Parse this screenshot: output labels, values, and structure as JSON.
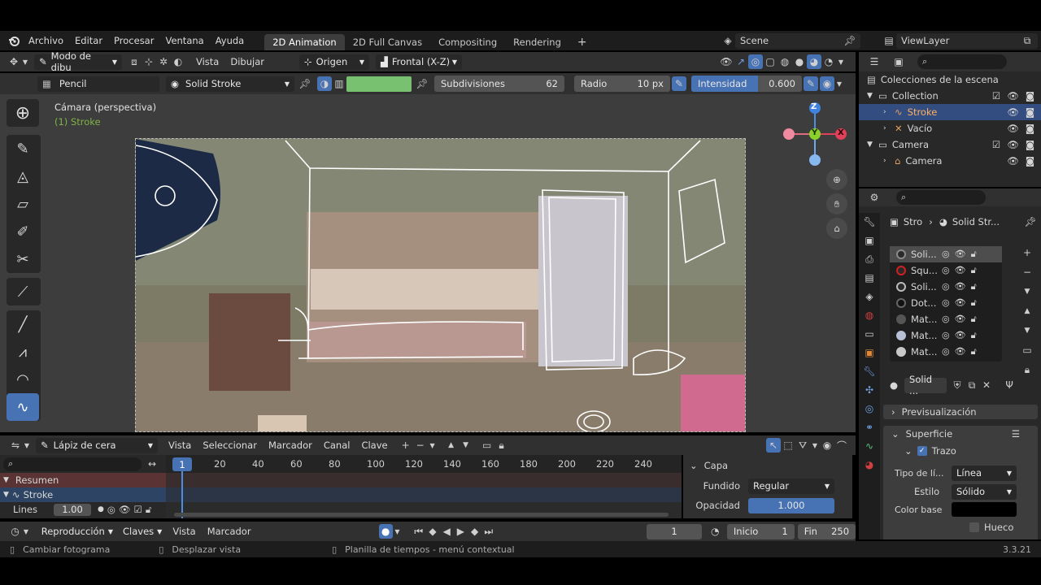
{
  "topbar": {
    "menus": [
      "Archivo",
      "Editar",
      "Procesar",
      "Ventana",
      "Ayuda"
    ],
    "workspaces": [
      "2D Animation",
      "2D Full Canvas",
      "Compositing",
      "Rendering"
    ],
    "add_tab": "+",
    "scene": "Scene",
    "view_layer": "ViewLayer"
  },
  "viewport_header": {
    "mode": "Modo de dibu",
    "view_menu": "Vista",
    "draw_menu": "Dibujar",
    "origin": "Origen",
    "orientation": "Frontal (X-Z)"
  },
  "tool_settings": {
    "brush": "Pencil",
    "material": "Solid Stroke",
    "color": "#78c170",
    "subdivisions_label": "Subdivisiones",
    "subdivisions_value": "62",
    "radius_label": "Radio",
    "radius_value": "10 px",
    "strength_label": "Intensidad",
    "strength_value": "0.600",
    "strength_fraction": 0.6
  },
  "viewport": {
    "camera_label": "Cámara (perspectiva)",
    "object_label": "(1) Stroke",
    "gizmo": {
      "z": "Z",
      "y": "Y",
      "x": "X"
    }
  },
  "outliner": {
    "root": "Colecciones de la escena",
    "items": [
      {
        "name": "Collection",
        "indent": 0,
        "icon": "collection-icon"
      },
      {
        "name": "Stroke",
        "indent": 1,
        "icon": "grease-pencil-icon",
        "selected": true
      },
      {
        "name": "Vacío",
        "indent": 1,
        "icon": "empty-icon"
      },
      {
        "name": "Camera",
        "indent": 0,
        "icon": "collection-icon"
      },
      {
        "name": "Camera",
        "indent": 1,
        "icon": "camera-icon"
      }
    ]
  },
  "properties": {
    "breadcrumb": [
      "Stro",
      "Solid Str..."
    ],
    "materials": [
      {
        "name": "Soli...",
        "color": "#2a2a2a",
        "ring": "#8a8a8a"
      },
      {
        "name": "Squ...",
        "color": "#2a2a2a",
        "ring": "#d02020"
      },
      {
        "name": "Soli...",
        "color": "#2a2a2a",
        "ring": "#bbbbbb"
      },
      {
        "name": "Dot...",
        "color": "#111111",
        "ring": "#666666"
      },
      {
        "name": "Mat...",
        "color": "#555555",
        "ring": "#555555"
      },
      {
        "name": "Mat...",
        "color": "#b8c0d8",
        "ring": "#b8c0d8"
      },
      {
        "name": "Mat...",
        "color": "#c8c8c8",
        "ring": "#c8c8c8"
      }
    ],
    "active_material": "Solid ...",
    "preview_label": "Previsualización",
    "surface_label": "Superficie",
    "stroke_label": "Trazo",
    "line_type_label": "Tipo de lí...",
    "line_type_value": "Línea",
    "style_label": "Estilo",
    "style_value": "Sólido",
    "base_color_label": "Color base",
    "base_color": "#000000",
    "holdout_label": "Hueco"
  },
  "dopesheet": {
    "mode": "Lápiz de cera",
    "menus": [
      "Vista",
      "Seleccionar",
      "Marcador",
      "Canal",
      "Clave"
    ],
    "ticks": [
      "20",
      "40",
      "60",
      "80",
      "100",
      "120",
      "140",
      "160",
      "180",
      "200",
      "220",
      "240"
    ],
    "current_frame": "1",
    "channels": {
      "summary": "Resumen",
      "object": "Stroke",
      "layer": "Lines",
      "layer_opacity": "1.00"
    },
    "sidebar": {
      "panel": "Capa",
      "blend_label": "Fundido",
      "blend_value": "Regular",
      "opacity_label": "Opacidad",
      "opacity_value": "1.000"
    }
  },
  "timeline": {
    "playback": "Reproducción",
    "keys": "Claves",
    "view": "Vista",
    "marker": "Marcador",
    "frame": "1",
    "start_label": "Inicio",
    "start_value": "1",
    "end_label": "Fin",
    "end_value": "250"
  },
  "statusbar": {
    "hint1": "Cambiar fotograma",
    "hint2": "Desplazar vista",
    "hint3": "Planilla de tiempos - menú contextual",
    "version": "3.3.21"
  }
}
